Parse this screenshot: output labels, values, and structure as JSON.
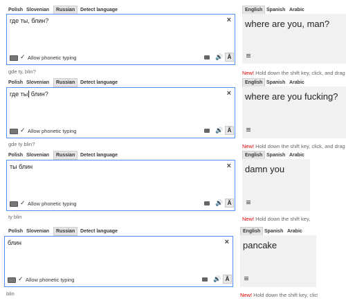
{
  "source_tabs": [
    "Polish",
    "Slovenian",
    "Russian",
    "Detect language"
  ],
  "target_tabs": [
    "English",
    "Spanish",
    "Arabic"
  ],
  "phonetic_label": "Allow phonetic typing",
  "close_glyph": "×",
  "speaker_glyph": "🔊",
  "phonetic_button_glyph": "Ă",
  "hint_new": "New!",
  "hint_text": " Hold down the shift key, click, and drag",
  "accent_color": "#4d90fe",
  "new_color": "#dd0000",
  "panels": [
    {
      "source_pre": "где ты, блин?",
      "source_post": "",
      "has_cursor": false,
      "transliteration": "gde ty, blin?",
      "translation": "where are you, man?"
    },
    {
      "source_pre": "где ты",
      "source_post": " блин?",
      "has_cursor": true,
      "transliteration": "gde ty blin?",
      "translation": "where are you fucking?"
    },
    {
      "source_pre": "ты блин",
      "source_post": "",
      "has_cursor": false,
      "transliteration": "ty blin",
      "translation": "damn you"
    },
    {
      "source_pre": "блин",
      "source_post": "",
      "has_cursor": false,
      "transliteration": "blin",
      "translation": "pancake"
    }
  ]
}
